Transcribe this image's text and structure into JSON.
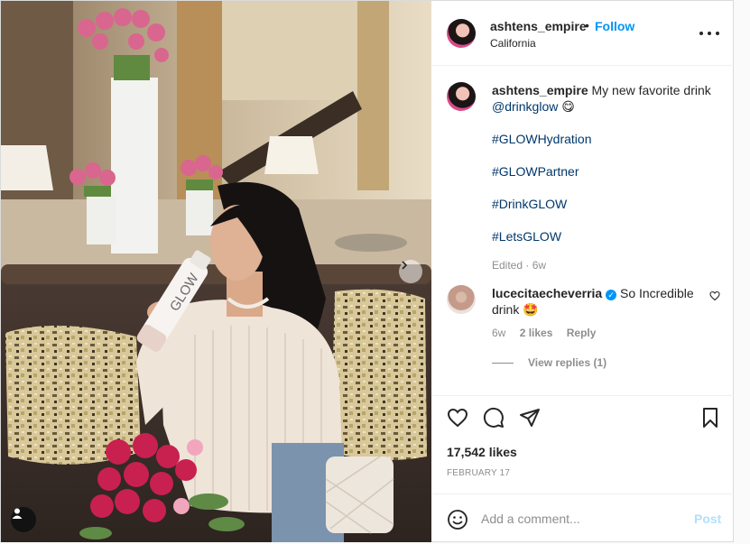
{
  "post": {
    "username": "ashtens_empire",
    "separator": "•",
    "follow_label": "Follow",
    "location": "California"
  },
  "photo": {
    "bottle_text": "GLOW",
    "icons": {
      "next": "chevron-right-icon",
      "tag": "user-tag-icon"
    }
  },
  "caption": {
    "username": "ashtens_empire",
    "text": "My new favorite drink",
    "mention": "@drinkglow",
    "emoji": "😋",
    "hashtags": [
      "#GLOWHydration",
      "#GLOWPartner",
      "#DrinkGLOW",
      "#LetsGLOW"
    ],
    "edited": "Edited",
    "age": "6w"
  },
  "comment": {
    "username": "lucecitaecheverria",
    "verified_mark": "✓",
    "text": "So Incredible drink",
    "emoji": "🤩",
    "age": "6w",
    "likes": "2 likes",
    "reply_label": "Reply",
    "view_replies": "View replies (1)"
  },
  "actions": {
    "icons": [
      "heart-icon",
      "comment-icon",
      "share-icon",
      "bookmark-icon"
    ]
  },
  "stats": {
    "likes": "17,542 likes",
    "date": "FEBRUARY 17"
  },
  "add_comment": {
    "placeholder": "Add a comment...",
    "post_label": "Post"
  },
  "colors": {
    "accent": "#0095f6",
    "link": "#00376b",
    "muted": "#8e8e8e",
    "text": "#262626",
    "post_disabled": "#b2dffc"
  }
}
